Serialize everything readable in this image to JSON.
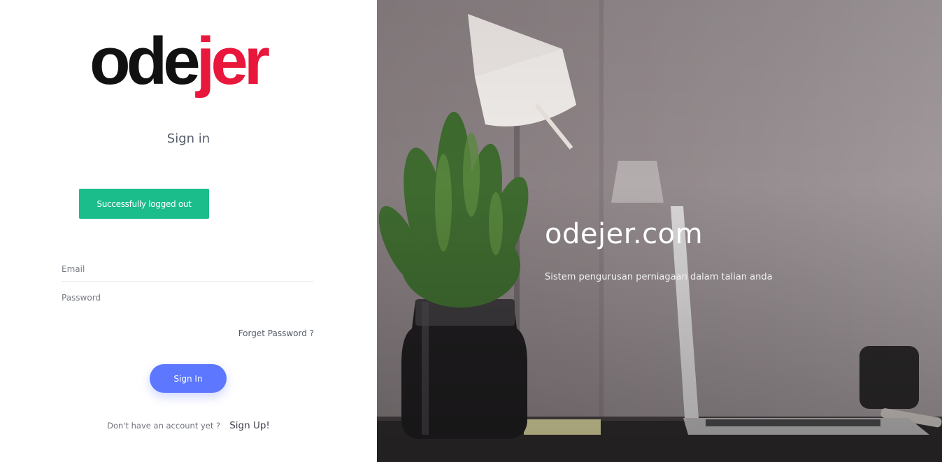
{
  "logo": {
    "part1": "ode",
    "part2": "jer",
    "accent_color": "#e8173b",
    "text_color": "#111111"
  },
  "form": {
    "title": "Sign in",
    "alert": "Successfully logged out",
    "email_placeholder": "Email",
    "password_placeholder": "Password",
    "forget_password": "Forget Password ?",
    "signin_button": "Sign In",
    "no_account_text": "Don't have an account yet ?",
    "signup_link": "Sign Up!"
  },
  "hero": {
    "title": "odejer.com",
    "subtitle": "Sistem pengurusan perniagaan dalam talian anda"
  },
  "colors": {
    "primary": "#5d78ff",
    "success": "#1bbd8b",
    "brand_red": "#e8173b"
  }
}
